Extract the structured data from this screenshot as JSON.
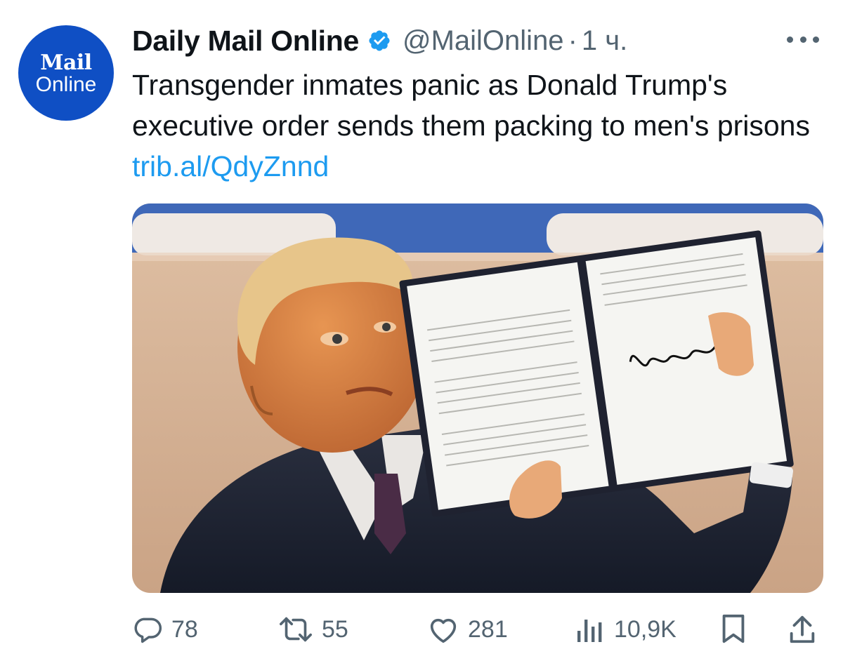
{
  "tweet": {
    "avatar": {
      "line1": "Mail",
      "line2": "Online"
    },
    "author_name": "Daily Mail Online",
    "verified": true,
    "handle": "@MailOnline",
    "separator": "·",
    "time": "1 ч.",
    "text": "Transgender inmates panic as Donald Trump's executive order sends them packing to men's prisons",
    "link": "trib.al/QdyZnnd",
    "media_icon": "photo-of-president-holding-signed-executive-order",
    "actions": {
      "replies": "78",
      "reposts": "55",
      "likes": "281",
      "views": "10,9K"
    }
  },
  "colors": {
    "text": "#0f1419",
    "secondary": "#536471",
    "link": "#1d9bf0",
    "avatar_bg": "#0f4fc4",
    "verified": "#1d9bf0"
  }
}
